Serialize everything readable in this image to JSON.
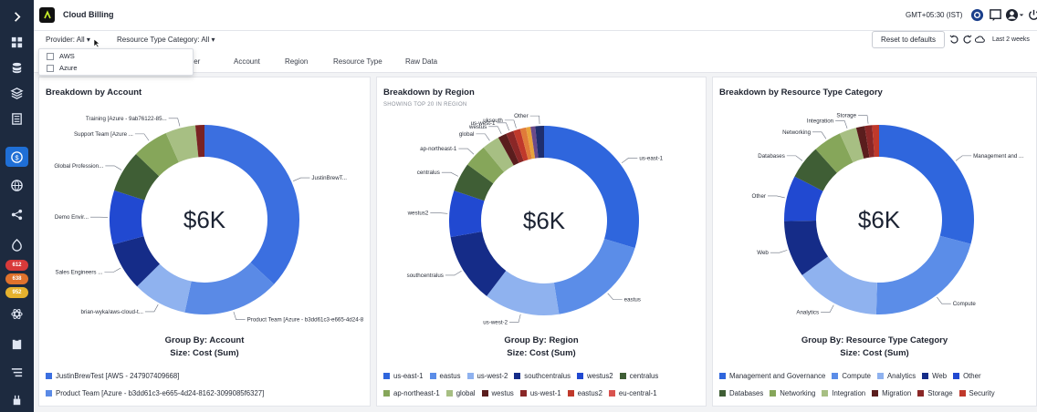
{
  "app": {
    "title": "Cloud Billing"
  },
  "topbar": {
    "timezone": "GMT+05:30 (IST)",
    "icons": [
      "app-badge-icon",
      "chat-icon",
      "user-icon",
      "power-icon"
    ]
  },
  "sidebar": {
    "items": [
      "chevron-right-icon",
      "dashboard-icon",
      "database-icon",
      "layers-icon",
      "list-icon",
      "billing-icon",
      "globe-icon",
      "share-icon",
      "alert-icon",
      "atom-icon",
      "clipboard-icon",
      "filter-icon",
      "plug-icon"
    ],
    "badges": [
      {
        "text": "612",
        "color": "#d83a3a"
      },
      {
        "text": "638",
        "color": "#e0722c"
      },
      {
        "text": "952",
        "color": "#e6b22e"
      }
    ]
  },
  "filters": {
    "provider": "Provider: All",
    "resource_type": "Resource Type Category: All",
    "reset": "Reset to defaults",
    "range": "Last 2 weeks"
  },
  "dropdown": {
    "options": [
      "AWS",
      "Azure"
    ]
  },
  "tabs": [
    "vider",
    "Account",
    "Region",
    "Resource Type",
    "Raw Data"
  ],
  "panels": [
    {
      "title": "Breakdown by Account",
      "subtitle": "",
      "center": "$6K",
      "group_by": "Group By: Account",
      "size": "Size: Cost (Sum)",
      "legend_rows": [
        [
          {
            "label": "JustinBrewTest [AWS - 247907409668]",
            "color": "#3b6fe0"
          }
        ],
        [
          {
            "label": "Product Team [Azure - b3dd61c3-e665-4d24-8162-3099085f6327]",
            "color": "#5a8ae6"
          }
        ]
      ]
    },
    {
      "title": "Breakdown by Region",
      "subtitle": "SHOWING TOP 20 IN REGION",
      "center": "$6K",
      "group_by": "Group By: Region",
      "size": "Size: Cost (Sum)",
      "legend_rows": [
        [
          {
            "label": "us-east-1",
            "color": "#2f66dd"
          },
          {
            "label": "eastus",
            "color": "#5b8de8"
          },
          {
            "label": "us-west-2",
            "color": "#8fb2ef"
          },
          {
            "label": "southcentralus",
            "color": "#152c88"
          },
          {
            "label": "westus2",
            "color": "#2149d1"
          },
          {
            "label": "centralus",
            "color": "#3f5e35"
          }
        ],
        [
          {
            "label": "ap-northeast-1",
            "color": "#86a65a"
          },
          {
            "label": "global",
            "color": "#a7bf83"
          },
          {
            "label": "westus",
            "color": "#5a1d1d"
          },
          {
            "label": "us-west-1",
            "color": "#8a2727"
          },
          {
            "label": "eastus2",
            "color": "#c0392b"
          },
          {
            "label": "eu-central-1",
            "color": "#d9534f"
          }
        ]
      ]
    },
    {
      "title": "Breakdown by Resource Type Category",
      "subtitle": "",
      "center": "$6K",
      "group_by": "Group By: Resource Type Category",
      "size": "Size: Cost (Sum)",
      "legend_rows": [
        [
          {
            "label": "Management and Governance",
            "color": "#2f66dd"
          },
          {
            "label": "Compute",
            "color": "#5b8de8"
          },
          {
            "label": "Analytics",
            "color": "#8fb2ef"
          },
          {
            "label": "Web",
            "color": "#152c88"
          },
          {
            "label": "Other",
            "color": "#2149d1"
          }
        ],
        [
          {
            "label": "Databases",
            "color": "#3f5e35"
          },
          {
            "label": "Networking",
            "color": "#86a65a"
          },
          {
            "label": "Integration",
            "color": "#a7bf83"
          },
          {
            "label": "Migration",
            "color": "#5a1d1d"
          },
          {
            "label": "Storage",
            "color": "#8a2727"
          },
          {
            "label": "Security",
            "color": "#c0392b"
          }
        ]
      ]
    }
  ],
  "chart_data": [
    {
      "type": "pie",
      "title": "Breakdown by Account",
      "labels": [
        "JustinBrewT...",
        "Product Team [Azure - b3dd61c3-e665-4d24-8",
        "brian-wyka/aws-cloud-t...",
        "Sales Engineers ...",
        "Demo Envir...",
        "Global Profession...",
        "Support Team [Azure ...",
        "Training [Azure - 9ab76122-85...",
        ""
      ],
      "values": [
        36,
        16,
        9,
        8,
        9,
        7,
        6,
        5,
        1.5
      ],
      "colors": [
        "#3b6fe0",
        "#5a8ae6",
        "#8fb2ef",
        "#152c88",
        "#2149d1",
        "#3f5e35",
        "#86a65a",
        "#a7bf83",
        "#7a2323"
      ]
    },
    {
      "type": "pie",
      "title": "Breakdown by Region",
      "labels": [
        "us-east-1",
        "eastus",
        "us-west-2",
        "southcentralus",
        "westus2",
        "centralus",
        "ap-northeast-1",
        "global",
        "westus",
        "us-west-1",
        "uksouth",
        "",
        "",
        "",
        "Other"
      ],
      "values": [
        30,
        18,
        13,
        12,
        8,
        5,
        4,
        3,
        1.5,
        1.3,
        1.2,
        1,
        0.8,
        0.8,
        1.5
      ],
      "colors": [
        "#2f66dd",
        "#5b8de8",
        "#8fb2ef",
        "#152c88",
        "#2149d1",
        "#3f5e35",
        "#86a65a",
        "#a7bf83",
        "#5a1d1d",
        "#8a2727",
        "#c0392b",
        "#e07b39",
        "#e8a33a",
        "#6b4a8a",
        "#1f2f6e"
      ]
    },
    {
      "type": "pie",
      "title": "Breakdown by Resource Type Category",
      "labels": [
        "Management and ...",
        "Compute",
        "Analytics",
        "Web",
        "Other",
        "Databases",
        "Networking",
        "Integration",
        "",
        "Storage",
        ""
      ],
      "values": [
        30,
        22,
        15,
        10,
        8,
        6,
        5,
        3,
        1.5,
        1.3,
        1.2
      ],
      "colors": [
        "#2f66dd",
        "#5b8de8",
        "#8fb2ef",
        "#152c88",
        "#2149d1",
        "#3f5e35",
        "#86a65a",
        "#a7bf83",
        "#5a1d1d",
        "#8a2727",
        "#c0392b"
      ]
    }
  ]
}
